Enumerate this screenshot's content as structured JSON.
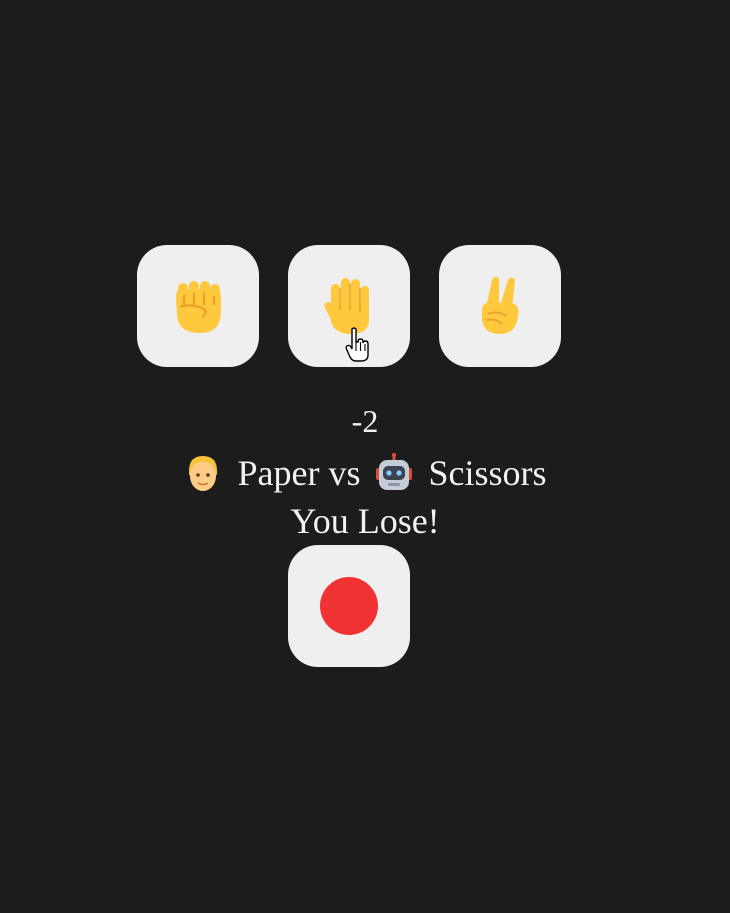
{
  "choices": [
    {
      "id": "rock",
      "icon": "raised-fist-icon"
    },
    {
      "id": "paper",
      "icon": "raised-hand-icon"
    },
    {
      "id": "scissors",
      "icon": "victory-hand-icon"
    }
  ],
  "score": "-2",
  "matchup": {
    "player_icon": "person-face-icon",
    "player_choice": "Paper",
    "versus": "vs",
    "bot_icon": "robot-face-icon",
    "bot_choice": "Scissors"
  },
  "result": "You Lose!",
  "record_button": {
    "icon": "red-circle-icon",
    "color": "#f03232"
  },
  "colors": {
    "background": "#1c1c1c",
    "tile": "#efefef",
    "text": "#f2f2f2",
    "emoji_yellow": "#ffc83d"
  }
}
